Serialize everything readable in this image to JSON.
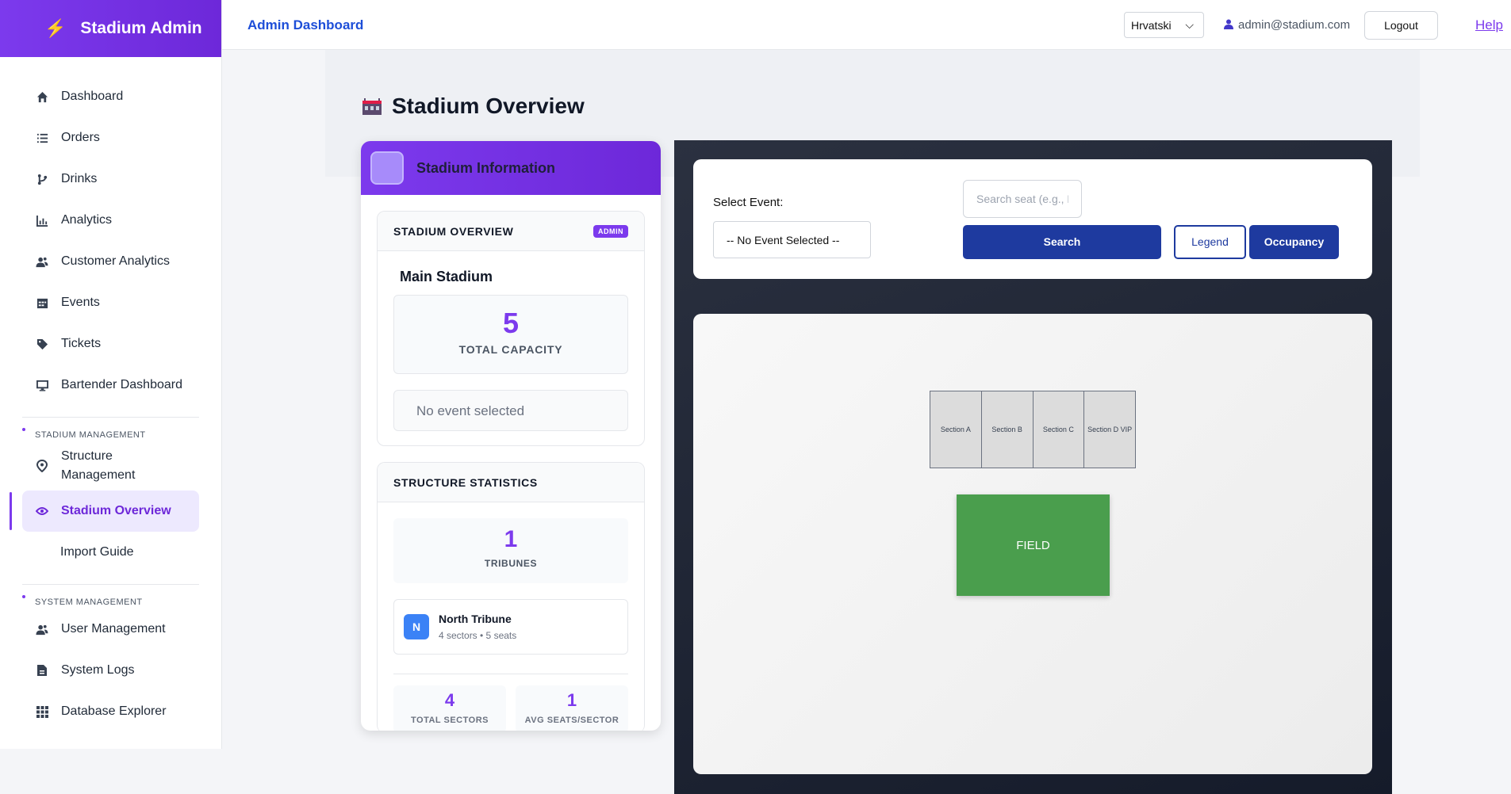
{
  "brand": {
    "name": "Stadium Admin"
  },
  "sidebar": {
    "items": [
      {
        "label": "Dashboard",
        "icon": "home-icon"
      },
      {
        "label": "Orders",
        "icon": "list-icon"
      },
      {
        "label": "Drinks",
        "icon": "branch-icon"
      },
      {
        "label": "Analytics",
        "icon": "bar-chart-icon"
      },
      {
        "label": "Customer Analytics",
        "icon": "users-icon"
      },
      {
        "label": "Events",
        "icon": "calendar-icon"
      },
      {
        "label": "Tickets",
        "icon": "tag-icon"
      },
      {
        "label": "Bartender Dashboard",
        "icon": "monitor-icon"
      }
    ],
    "stadium_section": "STADIUM MANAGEMENT",
    "stadium_items": [
      {
        "label": "Structure Management",
        "icon": "map-pin-icon"
      },
      {
        "label": "Stadium Overview",
        "icon": "eye-icon",
        "active": true
      },
      {
        "label": "Import Guide"
      }
    ],
    "system_section": "SYSTEM MANAGEMENT",
    "system_items": [
      {
        "label": "User Management",
        "icon": "users-icon"
      },
      {
        "label": "System Logs",
        "icon": "file-icon"
      },
      {
        "label": "Database Explorer",
        "icon": "grid-icon"
      }
    ]
  },
  "header": {
    "title": "Admin Dashboard",
    "language": "Hrvatski",
    "user_email": "admin@stadium.com",
    "logout_label": "Logout",
    "help_label": "Help"
  },
  "page": {
    "title": "Stadium Overview"
  },
  "info_card": {
    "title": "Stadium Information",
    "overview": {
      "heading": "STADIUM OVERVIEW",
      "badge": "ADMIN",
      "stadium_name": "Main Stadium",
      "capacity_value": "5",
      "capacity_label": "TOTAL CAPACITY",
      "event_status": "No event selected"
    },
    "structure": {
      "heading": "STRUCTURE STATISTICS",
      "tribunes_value": "1",
      "tribunes_label": "TRIBUNES",
      "tribune": {
        "initial": "N",
        "name": "North Tribune",
        "details": "4 sectors • 5 seats"
      },
      "total_sectors_value": "4",
      "total_sectors_label": "TOTAL SECTORS",
      "avg_seats_value": "1",
      "avg_seats_label": "AVG SEATS/SECTOR"
    }
  },
  "controls": {
    "select_event_label": "Select Event:",
    "event_value": "-- No Event Selected --",
    "search_placeholder": "Search seat (e.g., N",
    "search_label": "Search",
    "legend_label": "Legend",
    "occupancy_label": "Occupancy"
  },
  "map": {
    "sections": [
      "Section A",
      "Section B",
      "Section C",
      "Section D VIP"
    ],
    "field_label": "FIELD"
  },
  "colors": {
    "accent": "#7c3aed",
    "primary_button": "#1e3a9f",
    "field": "#4a9e4d"
  }
}
